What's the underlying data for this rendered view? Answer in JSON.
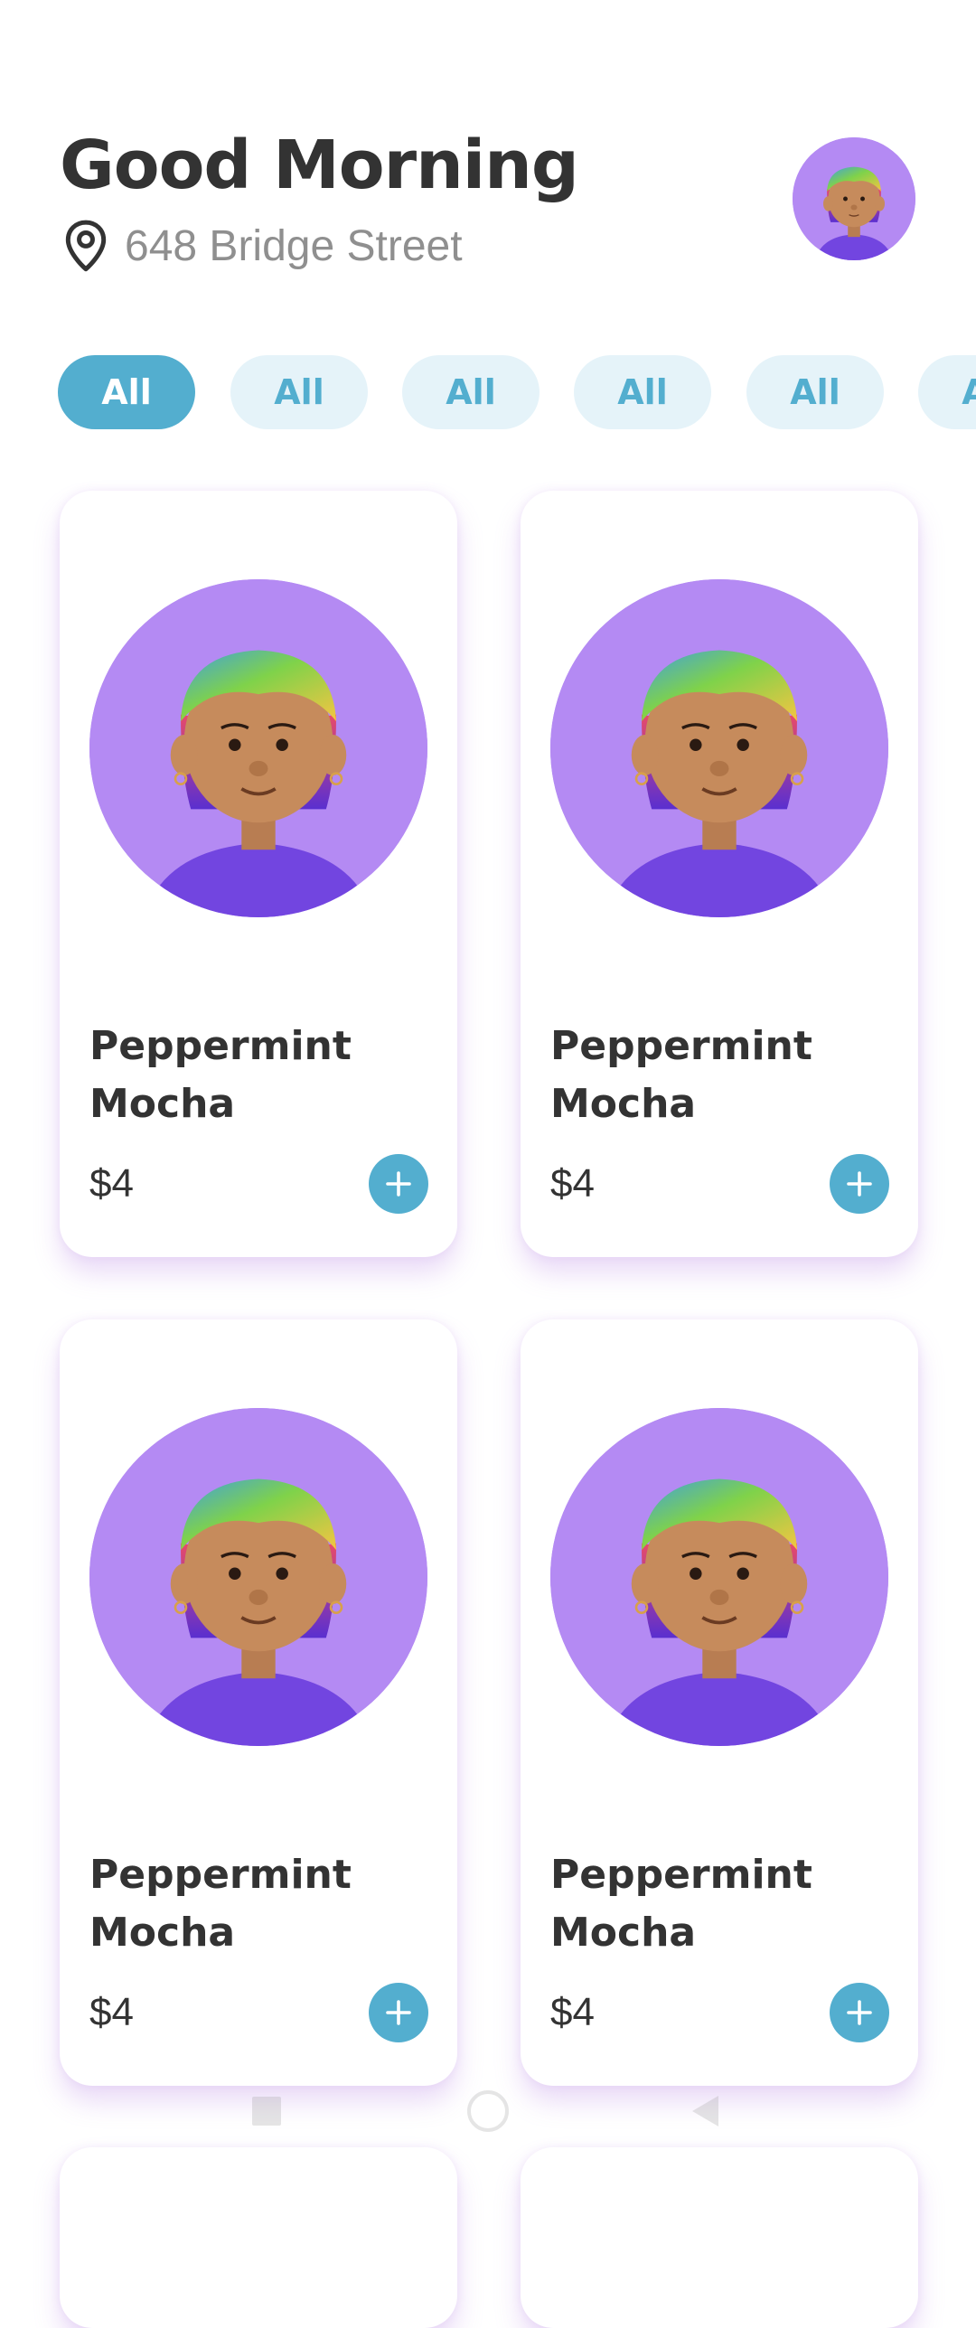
{
  "header": {
    "greeting": "Good Morning",
    "address": "648 Bridge Street",
    "location_icon": "map-pin-icon",
    "avatar": "user-avatar"
  },
  "categories": [
    {
      "label": "All",
      "active": true
    },
    {
      "label": "All",
      "active": false
    },
    {
      "label": "All",
      "active": false
    },
    {
      "label": "All",
      "active": false
    },
    {
      "label": "All",
      "active": false
    },
    {
      "label": "All",
      "active": false
    }
  ],
  "products": [
    {
      "name": "Peppermint Mocha",
      "price": "$4"
    },
    {
      "name": "Peppermint Mocha",
      "price": "$4"
    },
    {
      "name": "Peppermint Mocha",
      "price": "$4"
    },
    {
      "name": "Peppermint Mocha",
      "price": "$4"
    }
  ],
  "system_nav": {
    "recents_icon": "square-icon",
    "home_icon": "circle-icon",
    "back_icon": "triangle-back-icon"
  },
  "colors": {
    "accent": "#53aecf",
    "chip_inactive_bg": "#e5f3f9",
    "avatar_bg": "#b48af3",
    "text_primary": "#333333",
    "text_secondary": "#8f8f8f"
  }
}
